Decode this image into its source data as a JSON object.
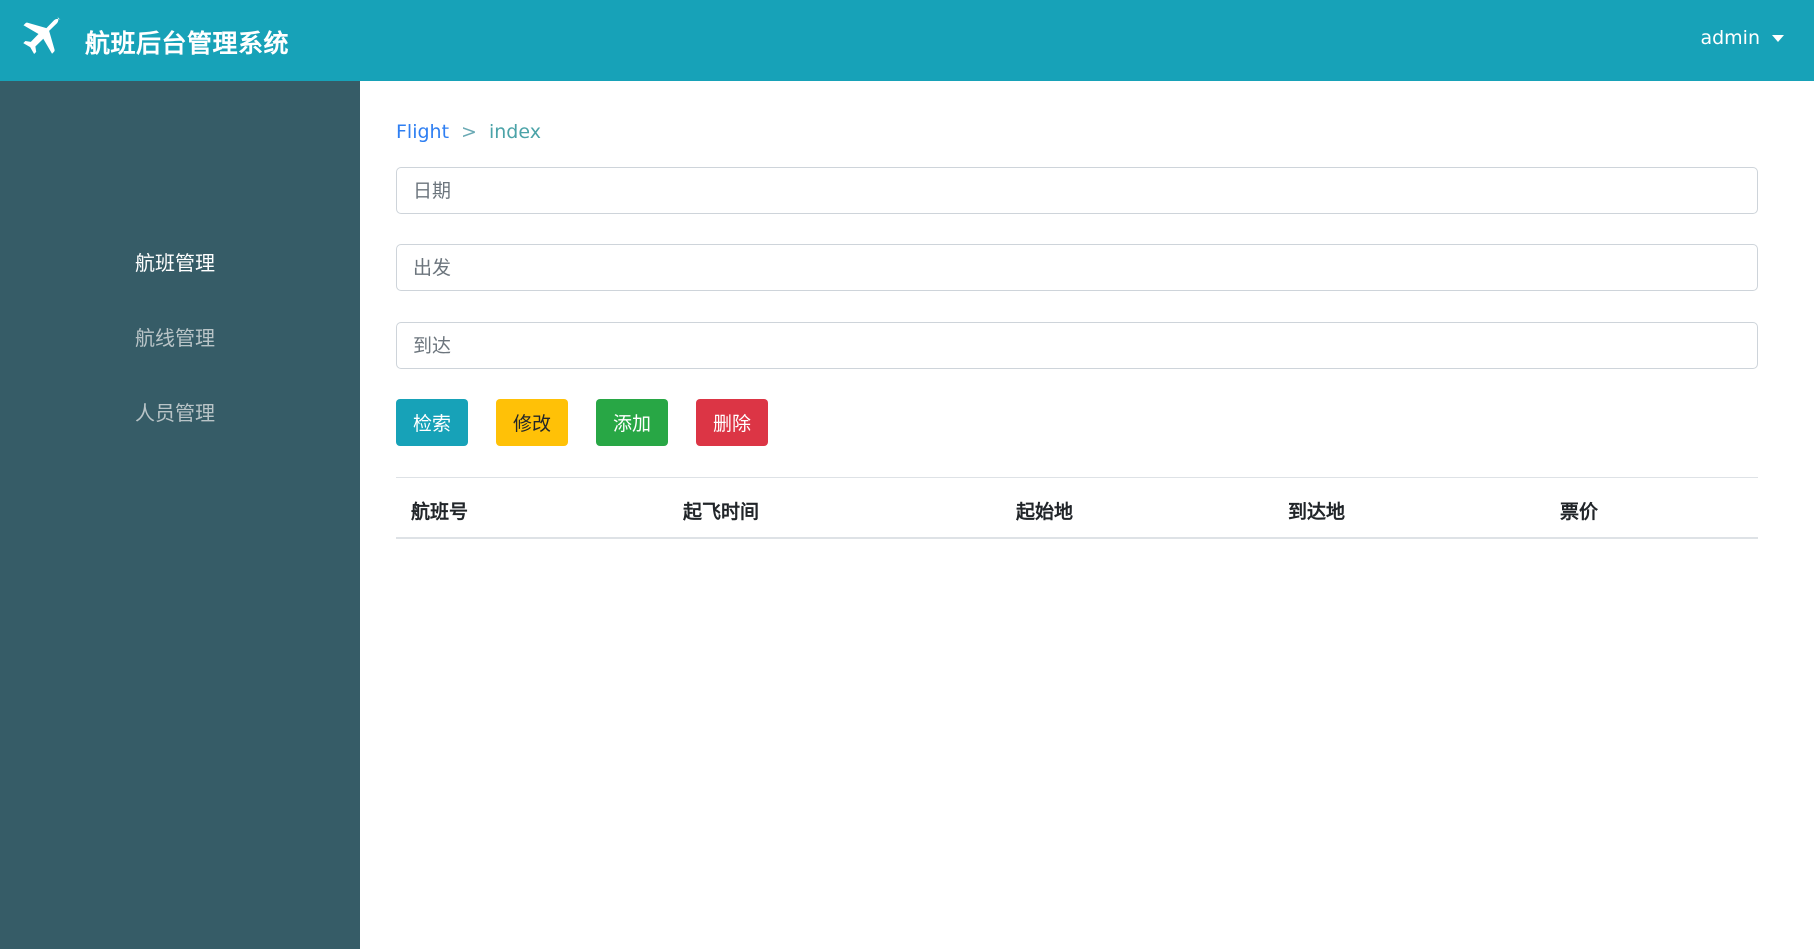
{
  "header": {
    "title": "航班后台管理系统",
    "logo_icon": "airplane-icon",
    "user": "admin",
    "user_menu_icon": "caret-down-icon"
  },
  "sidebar": {
    "items": [
      {
        "label": "航班管理",
        "active": true
      },
      {
        "label": "航线管理",
        "active": false
      },
      {
        "label": "人员管理",
        "active": false
      }
    ]
  },
  "breadcrumb": {
    "parent": "Flight",
    "separator": ">",
    "current": "index"
  },
  "search": {
    "date_placeholder": "日期",
    "departure_placeholder": "出发",
    "arrival_placeholder": "到达"
  },
  "actions": {
    "search": "检索",
    "edit": "修改",
    "add": "添加",
    "delete": "删除"
  },
  "table": {
    "columns": [
      "航班号",
      "起飞时间",
      "起始地",
      "到达地",
      "票价"
    ],
    "rows": []
  },
  "colors": {
    "header": "#17a2b8",
    "sidebar": "#365c67",
    "info": "#17a2b8",
    "warning": "#ffc107",
    "success": "#28a745",
    "danger": "#dc3545"
  }
}
